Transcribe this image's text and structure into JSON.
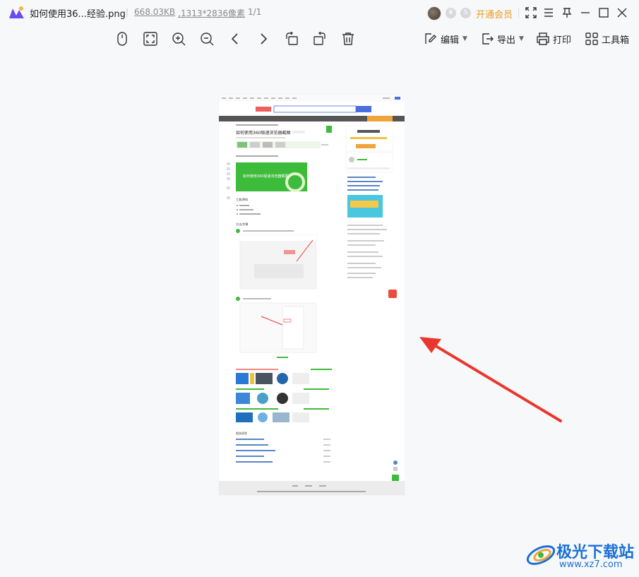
{
  "titlebar": {
    "filename": "如何使用36...经验.png",
    "filesize": "668.03KB",
    "dimensions": ",1313*2836像素",
    "page_index": "1/1",
    "vip_label": "开通会员"
  },
  "toolbar": {
    "edit_label": "编辑",
    "export_label": "导出",
    "print_label": "打印",
    "toolbox_label": "工具箱"
  },
  "watermark": {
    "brand": "极光下载站",
    "url": "www.xz7.com"
  },
  "document_preview": {
    "article_title": "如何使用360极速浏览器截图",
    "hero_text": "如何使用360极速浏览器截图",
    "section_tools": "工具/原料",
    "section_steps": "方法/步骤",
    "section_related": "相关经验"
  },
  "colors": {
    "accent_vip": "#e89a1a",
    "annotation_arrow": "#e8382e",
    "watermark_blue": "#1a6fd6",
    "hero_green": "#3dbb3a"
  }
}
